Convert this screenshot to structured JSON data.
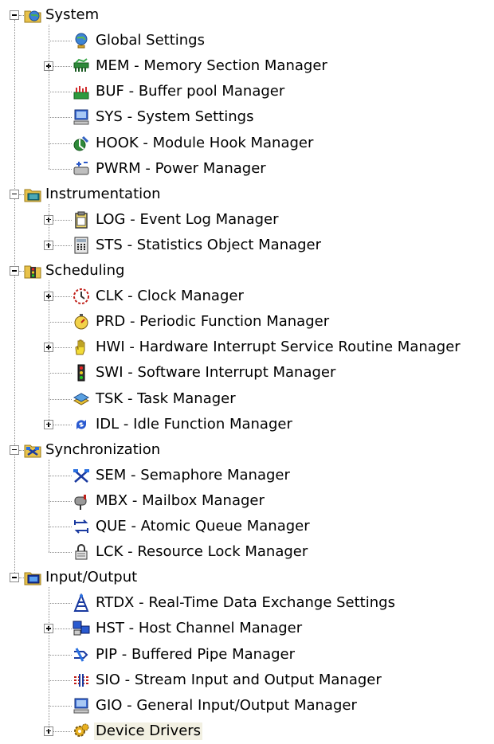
{
  "tree": {
    "groups": [
      {
        "label": "System",
        "icon": "folder-globe-icon",
        "expanded": true,
        "children": [
          {
            "label": "Global Settings",
            "icon": "globe-settings-icon",
            "expandable": false
          },
          {
            "label": "MEM - Memory Section Manager",
            "icon": "memory-icon",
            "expandable": true
          },
          {
            "label": "BUF - Buffer pool Manager",
            "icon": "buffer-pool-icon",
            "expandable": false
          },
          {
            "label": "SYS - System Settings",
            "icon": "computer-icon",
            "expandable": false
          },
          {
            "label": "HOOK - Module Hook Manager",
            "icon": "hook-icon",
            "expandable": false
          },
          {
            "label": "PWRM - Power Manager",
            "icon": "power-icon",
            "expandable": false
          }
        ]
      },
      {
        "label": "Instrumentation",
        "icon": "folder-instrument-icon",
        "expanded": true,
        "children": [
          {
            "label": "LOG - Event Log Manager",
            "icon": "clipboard-icon",
            "expandable": true
          },
          {
            "label": "STS - Statistics Object Manager",
            "icon": "calculator-icon",
            "expandable": true
          }
        ]
      },
      {
        "label": "Scheduling",
        "icon": "traffic-light-folder-icon",
        "expanded": true,
        "children": [
          {
            "label": "CLK - Clock Manager",
            "icon": "clock-icon",
            "expandable": true
          },
          {
            "label": "PRD - Periodic Function Manager",
            "icon": "stopwatch-icon",
            "expandable": false
          },
          {
            "label": "HWI - Hardware Interrupt Service Routine Manager",
            "icon": "hand-icon",
            "expandable": true
          },
          {
            "label": "SWI - Software Interrupt Manager",
            "icon": "traffic-light-icon",
            "expandable": false
          },
          {
            "label": "TSK - Task Manager",
            "icon": "books-icon",
            "expandable": false
          },
          {
            "label": "IDL - Idle Function Manager",
            "icon": "refresh-arrows-icon",
            "expandable": true
          }
        ]
      },
      {
        "label": "Synchronization",
        "icon": "semaphore-folder-icon",
        "expanded": true,
        "children": [
          {
            "label": "SEM - Semaphore Manager",
            "icon": "semaphore-flags-icon",
            "expandable": false
          },
          {
            "label": "MBX - Mailbox Manager",
            "icon": "mailbox-icon",
            "expandable": false
          },
          {
            "label": "QUE - Atomic Queue Manager",
            "icon": "queue-arrows-icon",
            "expandable": false
          },
          {
            "label": "LCK - Resource Lock Manager",
            "icon": "lock-icon",
            "expandable": false
          }
        ]
      },
      {
        "label": "Input/Output",
        "icon": "monitor-folder-icon",
        "expanded": true,
        "children": [
          {
            "label": "RTDX - Real-Time Data Exchange Settings",
            "icon": "antenna-icon",
            "expandable": false
          },
          {
            "label": "HST - Host Channel Manager",
            "icon": "host-channel-icon",
            "expandable": true
          },
          {
            "label": "PIP - Buffered Pipe Manager",
            "icon": "pipe-icon",
            "expandable": false
          },
          {
            "label": "SIO - Stream Input and Output Manager",
            "icon": "stream-io-icon",
            "expandable": false
          },
          {
            "label": "GIO - General Input/Output Manager",
            "icon": "computer-icon",
            "expandable": false
          },
          {
            "label": "Device Drivers",
            "icon": "gear-icon",
            "expandable": true,
            "selected": true
          }
        ]
      }
    ]
  }
}
